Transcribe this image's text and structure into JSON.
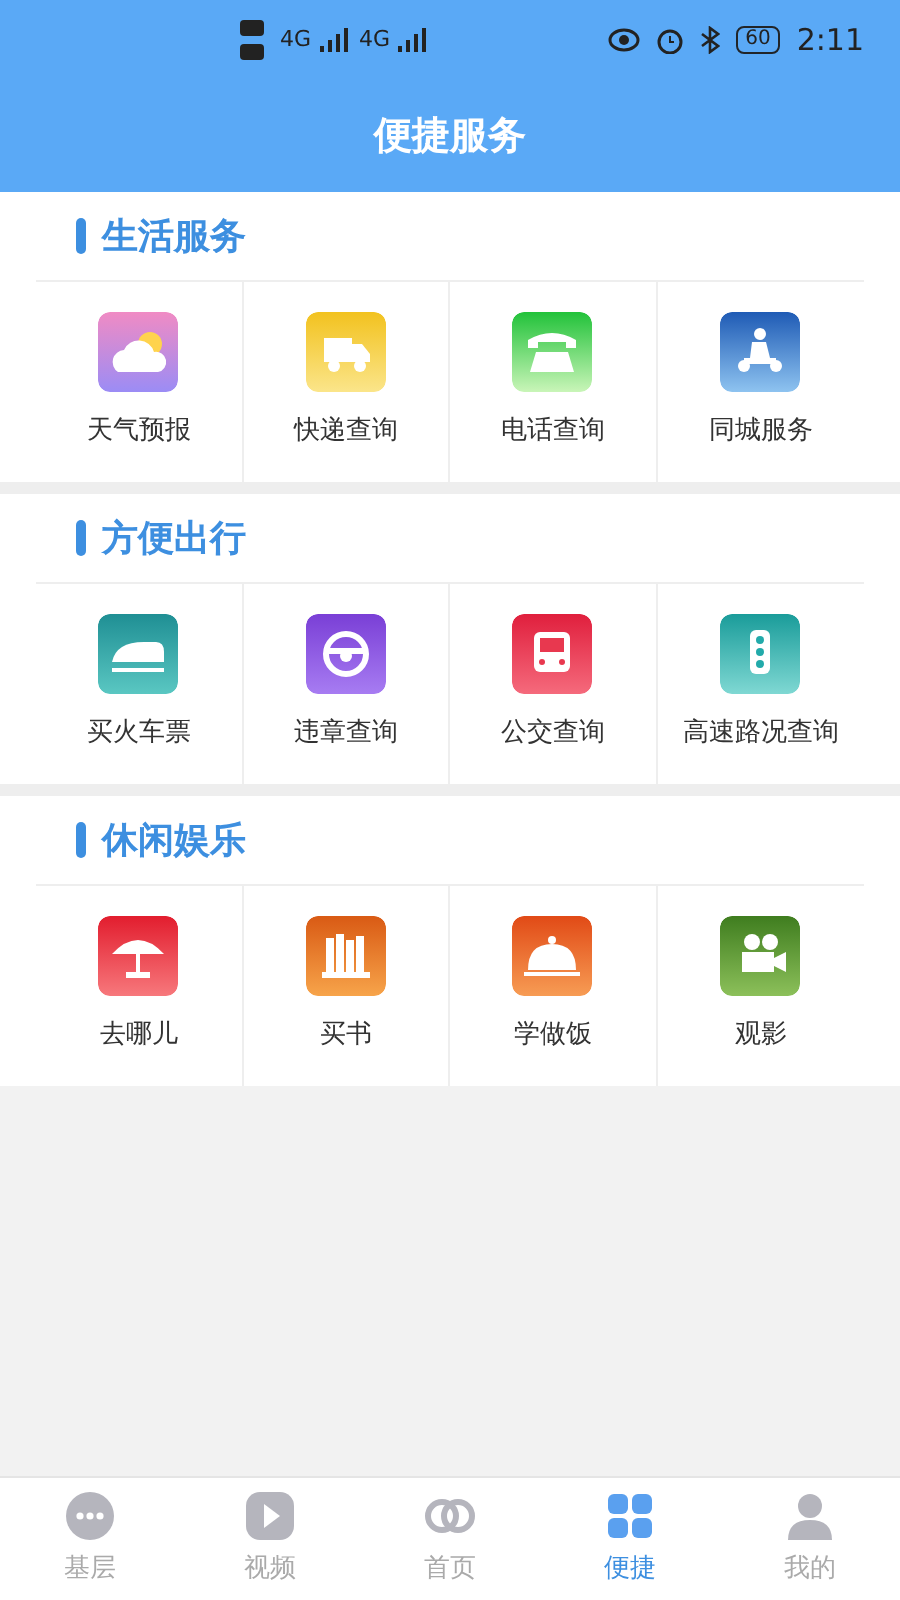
{
  "status_bar": {
    "network_1": "4G",
    "network_2": "4G",
    "battery": "60",
    "time": "2:11"
  },
  "header": {
    "title": "便捷服务"
  },
  "sections": [
    {
      "title": "生活服务",
      "items": [
        {
          "label": "天气预报"
        },
        {
          "label": "快递查询"
        },
        {
          "label": "电话查询"
        },
        {
          "label": "同城服务"
        }
      ]
    },
    {
      "title": "方便出行",
      "items": [
        {
          "label": "买火车票"
        },
        {
          "label": "违章查询"
        },
        {
          "label": "公交查询"
        },
        {
          "label": "高速路况查询"
        }
      ]
    },
    {
      "title": "休闲娱乐",
      "items": [
        {
          "label": "去哪儿"
        },
        {
          "label": "买书"
        },
        {
          "label": "学做饭"
        },
        {
          "label": "观影"
        }
      ]
    }
  ],
  "tab_bar": [
    {
      "label": "基层",
      "selected": false
    },
    {
      "label": "视频",
      "selected": false
    },
    {
      "label": "首页",
      "selected": false
    },
    {
      "label": "便捷",
      "selected": true
    },
    {
      "label": "我的",
      "selected": false
    }
  ]
}
